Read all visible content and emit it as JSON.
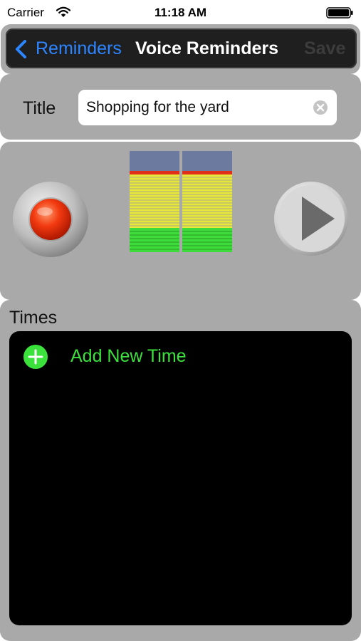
{
  "status_bar": {
    "carrier": "Carrier",
    "time": "11:18 AM"
  },
  "nav": {
    "back_label": "Reminders",
    "title": "Voice Reminders",
    "save_label": "Save"
  },
  "title_field": {
    "label": "Title",
    "value": "Shopping for the yard"
  },
  "recorder": {
    "record_icon": "record-icon",
    "play_icon": "play-icon",
    "level_icon": "level-meter-icon"
  },
  "times": {
    "label": "Times",
    "add_label": "Add New Time"
  },
  "colors": {
    "panel_gray": "#a9a9a9",
    "accent_blue": "#2d86ff",
    "add_green": "#3ce23c"
  }
}
